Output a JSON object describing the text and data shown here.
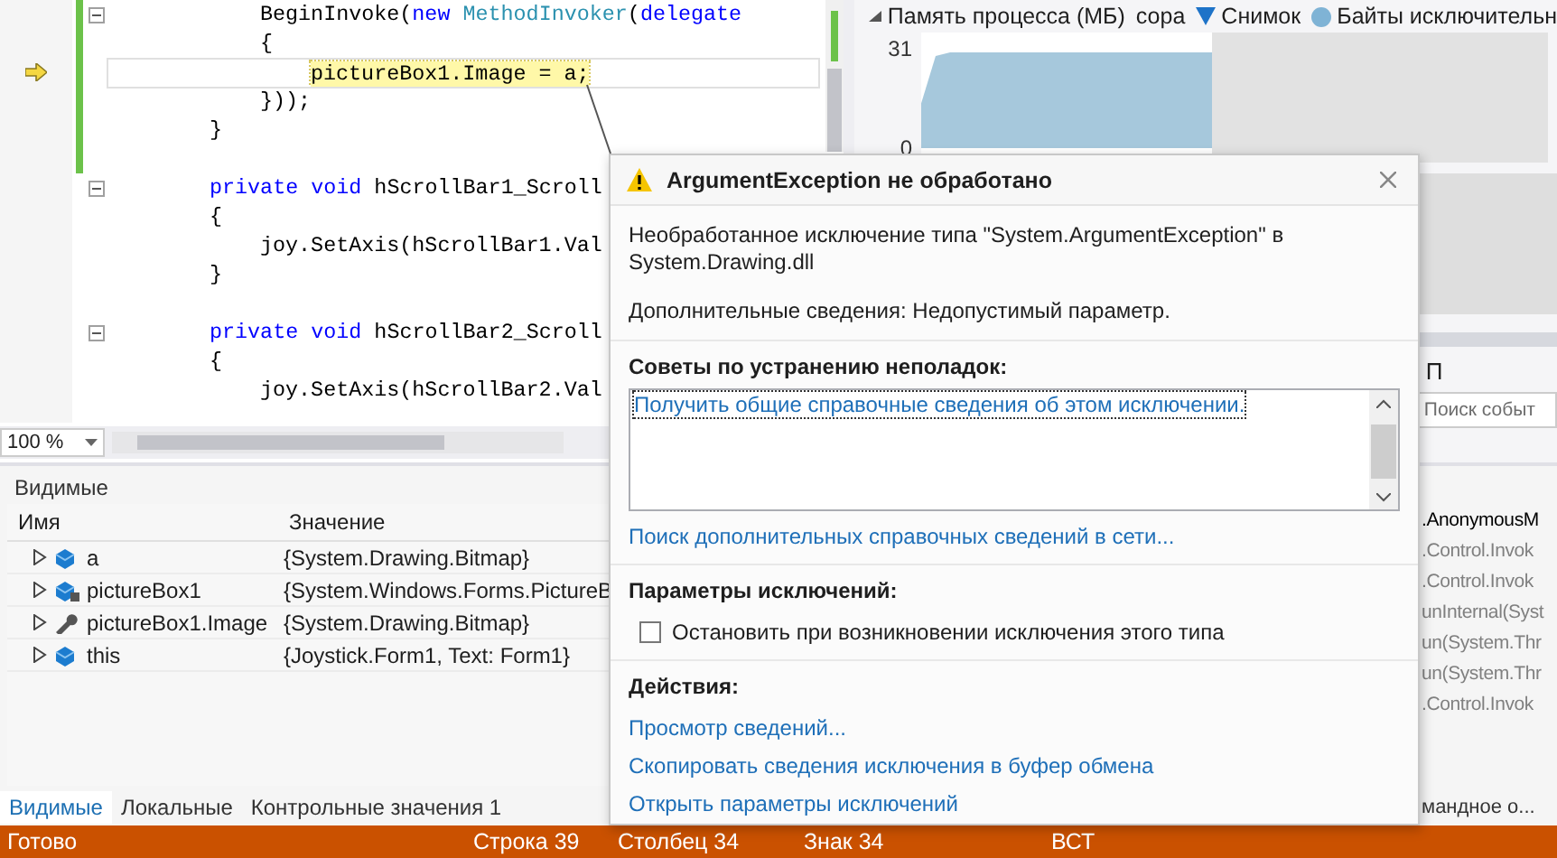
{
  "editor": {
    "lines": [
      {
        "kind": "group",
        "children": [
          {
            "kind": "code",
            "current": false,
            "modified": true,
            "fold_marker": true,
            "tokens": [
              {
                "kind": "plain",
                "text": "BeginInvoke("
              },
              {
                "kind": "keyword",
                "text": "new"
              },
              {
                "kind": "type",
                "text": " MethodInvoker"
              },
              {
                "kind": "plain",
                "text": "("
              },
              {
                "kind": "keyword",
                "text": "delegate"
              }
            ]
          },
          {
            "kind": "code",
            "current": false,
            "modified": true,
            "fold_marker": false,
            "tokens": [
              {
                "kind": "plain",
                "text": "{"
              }
            ],
            "children": [
              {
                "kind": "code",
                "current": true,
                "modified": true,
                "fold_marker": false,
                "tokens": [
                  {
                    "kind": "plain",
                    "text": "pictureBox1.Image = a;"
                  }
                ]
              }
            ]
          },
          {
            "kind": "code",
            "current": false,
            "modified": true,
            "fold_marker": false,
            "tokens": [
              {
                "kind": "plain",
                "text": "}));"
              }
            ]
          }
        ]
      },
      {
        "kind": "code",
        "current": false,
        "modified": true,
        "fold_marker": false,
        "tokens": [
          {
            "kind": "plain",
            "text": "}"
          }
        ]
      },
      {
        "kind": "blank",
        "modified": true
      },
      {
        "kind": "code",
        "current": false,
        "modified": false,
        "fold_marker": true,
        "tokens": [
          {
            "kind": "keyword",
            "text": "private void"
          },
          {
            "kind": "plain",
            "text": " hScrollBar1_Scroll"
          }
        ]
      },
      {
        "kind": "code",
        "current": false,
        "modified": false,
        "fold_marker": false,
        "tokens": [
          {
            "kind": "plain",
            "text": "{"
          }
        ],
        "children": [
          {
            "kind": "code",
            "current": false,
            "modified": false,
            "fold_marker": false,
            "tokens": [
              {
                "kind": "plain",
                "text": "joy.SetAxis(hScrollBar1.Val"
              }
            ]
          }
        ]
      },
      {
        "kind": "code",
        "current": false,
        "modified": false,
        "fold_marker": false,
        "tokens": [
          {
            "kind": "plain",
            "text": "}"
          }
        ]
      },
      {
        "kind": "blank",
        "modified": false
      },
      {
        "kind": "code",
        "current": false,
        "modified": false,
        "fold_marker": true,
        "tokens": [
          {
            "kind": "keyword",
            "text": "private void"
          },
          {
            "kind": "plain",
            "text": " hScrollBar2_Scroll"
          }
        ]
      },
      {
        "kind": "code",
        "current": false,
        "modified": false,
        "fold_marker": false,
        "tokens": [
          {
            "kind": "plain",
            "text": "{"
          }
        ],
        "children": [
          {
            "kind": "code",
            "current": false,
            "modified": false,
            "fold_marker": false,
            "tokens": [
              {
                "kind": "plain",
                "text": "joy.SetAxis(hScrollBar2.Val"
              }
            ]
          }
        ]
      }
    ],
    "zoom": "100 %"
  },
  "diagnostics": {
    "legend": [
      {
        "kind": "text",
        "label": "сора"
      },
      {
        "kind": "triangle",
        "label": "Снимок"
      },
      {
        "kind": "dot",
        "label": "Байты исключительн"
      }
    ],
    "memory_graph": {
      "title": "Память процесса (МБ)",
      "axis_labels": [
        "31",
        "0"
      ]
    },
    "events_heading": "П",
    "events_search": {
      "placeholder": "Поиск событ"
    }
  },
  "locals": {
    "title": "Видимые",
    "columns": [
      "Имя",
      "Значение"
    ],
    "rows": [
      {
        "kind": "field",
        "expanded": false,
        "name": "a",
        "value": "{System.Drawing.Bitmap}"
      },
      {
        "kind": "private-field",
        "expanded": false,
        "name": "pictureBox1",
        "value": "{System.Windows.Forms.PictureB"
      },
      {
        "kind": "property",
        "expanded": false,
        "name": "pictureBox1.Image",
        "value": "{System.Drawing.Bitmap}"
      },
      {
        "kind": "field",
        "expanded": false,
        "name": "this",
        "value": "{Joystick.Form1, Text: Form1}"
      }
    ],
    "tabs": [
      {
        "label": "Видимые",
        "selected": true
      },
      {
        "label": "Локальные",
        "selected": false
      },
      {
        "label": "Контрольные значения 1",
        "selected": false
      }
    ]
  },
  "call_stack": {
    "rows": [
      {
        "text": ".AnonymousM",
        "current": true
      },
      {
        "text": ".Control.Invok",
        "current": false
      },
      {
        "text": ".Control.Invok",
        "current": false
      },
      {
        "text": "unInternal(Syst",
        "current": false
      },
      {
        "text": "un(System.Thr",
        "current": false
      },
      {
        "text": "un(System.Thr",
        "current": false
      },
      {
        "text": ".Control.Invok",
        "current": false
      }
    ],
    "tabs": [
      {
        "label": "мандное о...",
        "selected": false
      }
    ]
  },
  "exception": {
    "title": "ArgumentException не обработано",
    "message": "Необработанное исключение типа \"System.ArgumentException\" в System.Drawing.dll",
    "details": "Дополнительные сведения: Недопустимый параметр.",
    "tips_heading": "Советы по устранению неполадок:",
    "tips": [
      "Получить общие справочные сведения об этом исключении."
    ],
    "online_link": "Поиск дополнительных справочных сведений в сети...",
    "settings_heading": "Параметры исключений:",
    "break_option": {
      "label": "Остановить при возникновении исключения этого типа",
      "checked": false
    },
    "actions_heading": "Действия:",
    "actions": [
      "Просмотр сведений...",
      "Скопировать сведения исключения в буфер обмена",
      "Открыть параметры исключений"
    ]
  },
  "status_bar": {
    "items": [
      "Готово",
      "Строка 39",
      "Столбец 34",
      "Знак 34",
      "ВСТ"
    ]
  }
}
